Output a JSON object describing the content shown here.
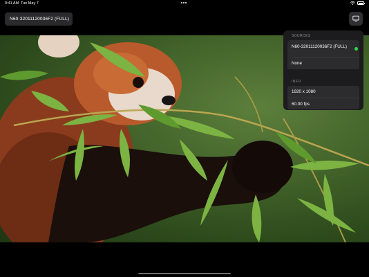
{
  "status_bar": {
    "time": "9:41 AM",
    "date": "Tue May 7"
  },
  "top_bar": {
    "source_label": "N60-32011120036F2 (FULL)"
  },
  "panel": {
    "sources_title": "SOURCES",
    "source_name": "N60-32011120036F2 (FULL)",
    "source_none": "None",
    "info_title": "INFO",
    "resolution": "1920 x 1080",
    "fps": "60.00 fps"
  },
  "colors": {
    "active_dot": "#32d74b",
    "panel_bg": "#1c1c1e",
    "row_bg": "#2c2c2e"
  },
  "icons": [
    "wifi-icon",
    "battery-icon",
    "display-icon",
    "more-dots-icon"
  ]
}
